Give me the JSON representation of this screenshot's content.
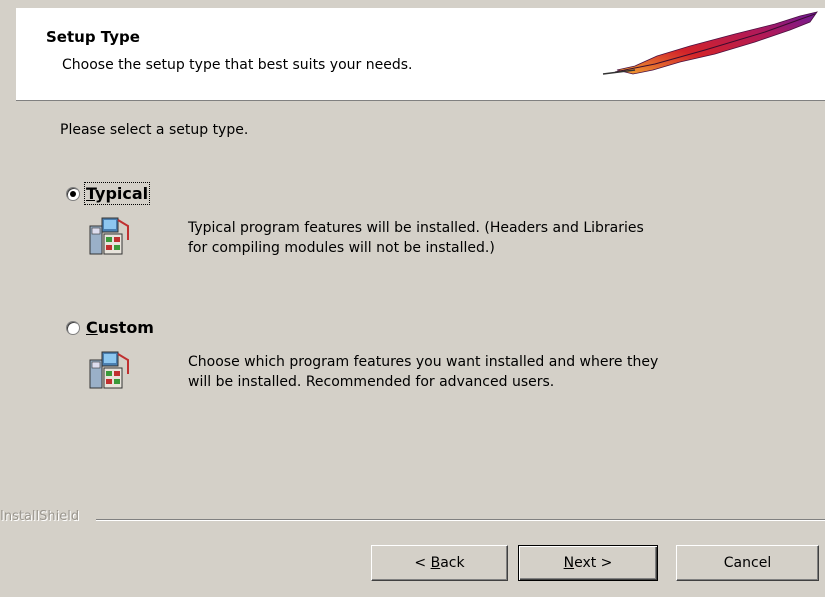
{
  "header": {
    "title": "Setup Type",
    "subtitle": "Choose the setup type that best suits your needs."
  },
  "prompt": "Please select a setup type.",
  "options": [
    {
      "label_accel": "T",
      "label_rest": "ypical",
      "selected": true,
      "description_line1": "Typical program features will be installed.  (Headers and Libraries",
      "description_line2": "for compiling modules will not be installed.)"
    },
    {
      "label_accel": "C",
      "label_rest": "ustom",
      "selected": false,
      "description_line1": "Choose which program features you want installed and where they",
      "description_line2": "will be installed. Recommended for advanced users."
    }
  ],
  "brand": "InstallShield",
  "buttons": {
    "back_prefix": "< ",
    "back_accel": "B",
    "back_rest": "ack",
    "next_accel": "N",
    "next_rest": "ext >",
    "cancel": "Cancel"
  },
  "colors": {
    "dialog_bg": "#d4d0c8",
    "header_bg": "#ffffff",
    "feather_red": "#c8102e",
    "feather_purple": "#6a1b9a"
  },
  "icons": {
    "header": "apache-feather-icon",
    "typical": "setup-components-icon",
    "custom": "setup-components-icon"
  }
}
